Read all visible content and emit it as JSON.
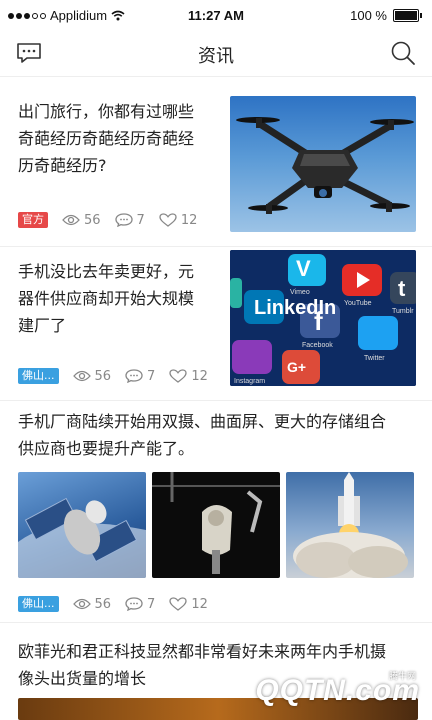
{
  "status_bar": {
    "carrier": "Applidium",
    "time": "11:27 AM",
    "battery": "100 %"
  },
  "nav": {
    "title": "资讯",
    "left_icon": "message-icon",
    "right_icon": "search-icon"
  },
  "articles": [
    {
      "title_lines": [
        "出门旅行，你都有过哪些",
        "奇葩经历奇葩经历奇葩经",
        "历奇葩经历?"
      ],
      "tag": "官方",
      "tag_color": "#e64848",
      "views": "56",
      "comments": "7",
      "likes": "12",
      "image": "drone"
    },
    {
      "title_lines": [
        "手机没比去年卖更好，元",
        "器件供应商却开始大规模",
        "建厂了"
      ],
      "tag": "佛山...",
      "tag_color": "#3aa0e0",
      "views": "56",
      "comments": "7",
      "likes": "12",
      "image": "social-apps",
      "app_labels": [
        "Vimeo",
        "YouTube",
        "Tumblr",
        "LinkedIn",
        "Facebook",
        "Twitter",
        "Instagram",
        "G+"
      ]
    },
    {
      "title_lines": [
        "手机厂商陆续开始用双摄、曲面屏、更大的存储组合",
        "供应商也要提升产能了。"
      ],
      "tag": "佛山...",
      "tag_color": "#3aa0e0",
      "views": "56",
      "comments": "7",
      "likes": "12",
      "images": [
        "spacecraft",
        "space-station",
        "rocket-launch"
      ]
    },
    {
      "title_lines": [
        "欧菲光和君正科技显然都非常看好未来两年内手机摄",
        "像头出货量的增长"
      ]
    }
  ],
  "watermark": {
    "text": "QQTN.com",
    "small": "腾牛网"
  }
}
